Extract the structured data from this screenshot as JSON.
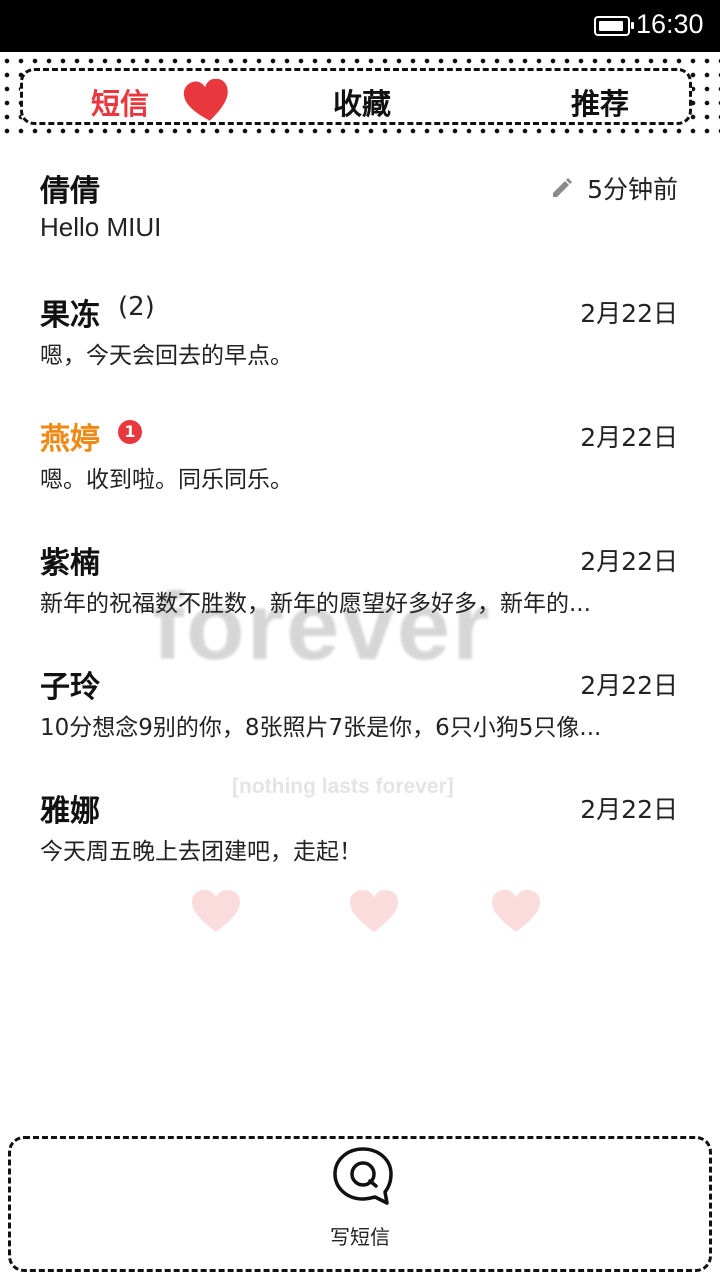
{
  "status_bar": {
    "time": "16:30"
  },
  "tabs": [
    {
      "label": "短信",
      "active": true
    },
    {
      "label": "收藏",
      "active": false
    },
    {
      "label": "推荐",
      "active": false
    }
  ],
  "colors": {
    "accent": "#e8383d",
    "unread_name": "#f08a16",
    "text": "#111111"
  },
  "conversations": [
    {
      "name": "倩倩",
      "preview": "Hello MIUI",
      "time": "5分钟前",
      "icon": "pencil-icon"
    },
    {
      "name": "果冻",
      "count": "(2)",
      "preview": "嗯，今天会回去的早点。",
      "time": "2月22日"
    },
    {
      "name": "燕婷",
      "unread_badge": "1",
      "preview": "嗯。收到啦。同乐同乐。",
      "time": "2月22日"
    },
    {
      "name": "紫楠",
      "preview": "新年的祝福数不胜数，新年的愿望好多好多，新年的...",
      "time": "2月22日"
    },
    {
      "name": "子玲",
      "preview": "10分想念9别的你，8张照片7张是你，6只小狗5只像...",
      "time": "2月22日"
    },
    {
      "name": "雅娜",
      "preview": "今天周五晚上去团建吧，走起！",
      "time": "2月22日"
    }
  ],
  "wallpaper": {
    "title": "forever",
    "subtitle": "[nothing lasts forever]"
  },
  "compose": {
    "label": "写短信",
    "icon": "chat-bubble-icon"
  }
}
